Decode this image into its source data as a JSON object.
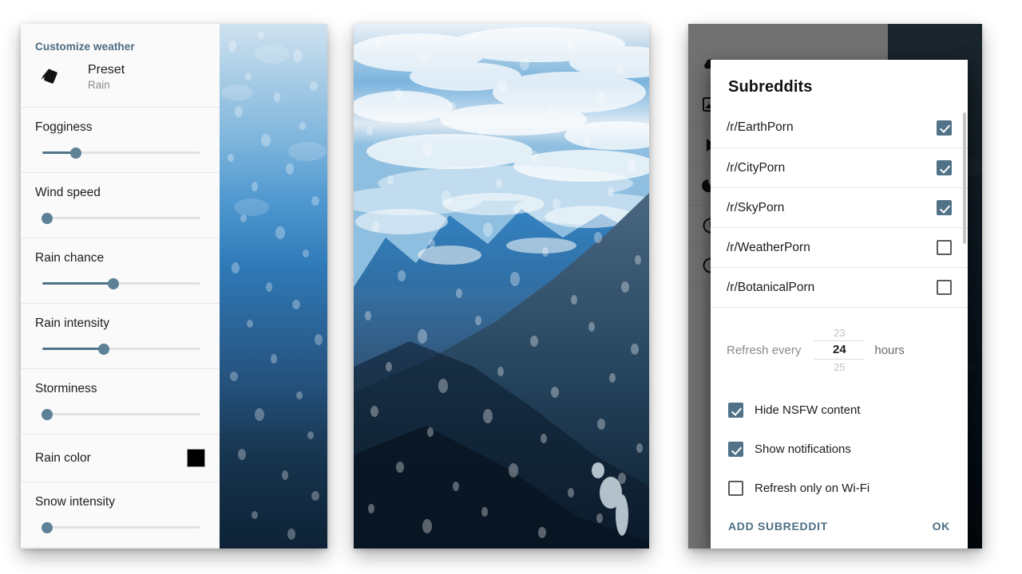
{
  "colors": {
    "accent": "#4d6f85",
    "slider_active": "#4f7287",
    "slider_thumb": "#5e8197",
    "slider_inactive": "#e2e2e2",
    "checkbox_checked": "#517287",
    "section_title": "#4b6b80",
    "rain_color_swatch": "#000000",
    "scrim": "rgba(0,0,0,0.55)"
  },
  "settings_panel": {
    "section_title": "Customize weather",
    "preset": {
      "icon": "palette-cards-icon",
      "label": "Preset",
      "value": "Rain"
    },
    "sliders": [
      {
        "label": "Fogginess",
        "value": 21
      },
      {
        "label": "Wind speed",
        "value": 3
      },
      {
        "label": "Rain chance",
        "value": 45
      },
      {
        "label": "Rain intensity",
        "value": 39
      },
      {
        "label": "Storminess",
        "value": 3
      },
      {
        "label": "Snow intensity",
        "value": 3
      }
    ],
    "color_setting": {
      "label": "Rain color",
      "swatch": "#000000"
    }
  },
  "photo_panel": {
    "description": "rainy-window-mountain-photo"
  },
  "dialog_panel": {
    "drawer_icons": [
      "cloud-icon",
      "image-icon",
      "play-icon",
      "moon-icon",
      "clock-icon",
      "circle-icon"
    ],
    "dialog": {
      "title": "Subreddits",
      "subreddits": [
        {
          "name": "/r/EarthPorn",
          "checked": true
        },
        {
          "name": "/r/CityPorn",
          "checked": true
        },
        {
          "name": "/r/SkyPorn",
          "checked": true
        },
        {
          "name": "/r/WeatherPorn",
          "checked": false
        },
        {
          "name": "/r/BotanicalPorn",
          "checked": false
        }
      ],
      "refresh": {
        "label": "Refresh every",
        "value_above": "23",
        "value": "24",
        "value_below": "25",
        "unit": "hours"
      },
      "options": [
        {
          "label": "Hide NSFW content",
          "checked": true
        },
        {
          "label": "Show notifications",
          "checked": true
        },
        {
          "label": "Refresh only on Wi-Fi",
          "checked": false
        }
      ],
      "actions": {
        "add": "ADD SUBREDDIT",
        "ok": "OK"
      }
    }
  }
}
